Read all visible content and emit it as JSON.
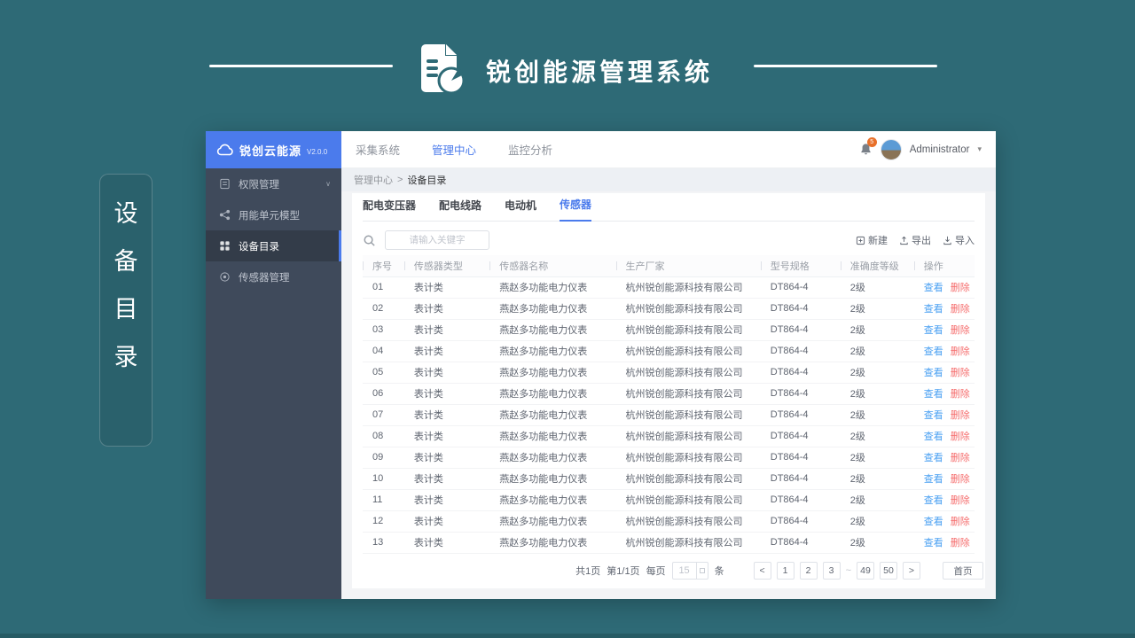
{
  "header": {
    "title": "锐创能源管理系统"
  },
  "side_label": {
    "chars": [
      "设",
      "备",
      "目",
      "录"
    ]
  },
  "app": {
    "sidebar": {
      "logo_text": "锐创云能源",
      "version": "V2.0.0",
      "items": [
        {
          "label": "权限管理",
          "icon": "document-icon",
          "chevron": true,
          "active": false
        },
        {
          "label": "用能单元模型",
          "icon": "share-icon",
          "chevron": false,
          "active": false
        },
        {
          "label": "设备目录",
          "icon": "grid-icon",
          "chevron": false,
          "active": true
        },
        {
          "label": "传感器管理",
          "icon": "target-icon",
          "chevron": false,
          "active": false
        }
      ]
    },
    "topnav": {
      "items": [
        {
          "label": "采集系统",
          "active": false
        },
        {
          "label": "管理中心",
          "active": true
        },
        {
          "label": "监控分析",
          "active": false
        }
      ],
      "badge": "5",
      "user_name": "Administrator"
    },
    "breadcrumb": {
      "parent": "管理中心",
      "separator": ">",
      "current": "设备目录"
    },
    "tabs": [
      {
        "label": "配电变压器",
        "active": false
      },
      {
        "label": "配电线路",
        "active": false
      },
      {
        "label": "电动机",
        "active": false
      },
      {
        "label": "传感器",
        "active": true
      }
    ],
    "toolbar": {
      "search_placeholder": "请输入关键字",
      "buttons": [
        {
          "label": "新建",
          "icon": "new-icon"
        },
        {
          "label": "导出",
          "icon": "export-icon"
        },
        {
          "label": "导入",
          "icon": "import-icon"
        }
      ]
    },
    "table": {
      "columns": [
        "序号",
        "传感器类型",
        "传感器名称",
        "生产厂家",
        "型号规格",
        "准确度等级",
        "操作"
      ],
      "action_view": "查看",
      "action_delete": "删除",
      "rows": [
        {
          "no": "01",
          "type": "表计类",
          "name": "燕赵多功能电力仪表",
          "vendor": "杭州锐创能源科技有限公司",
          "model": "DT864-4",
          "accuracy": "2级"
        },
        {
          "no": "02",
          "type": "表计类",
          "name": "燕赵多功能电力仪表",
          "vendor": "杭州锐创能源科技有限公司",
          "model": "DT864-4",
          "accuracy": "2级"
        },
        {
          "no": "03",
          "type": "表计类",
          "name": "燕赵多功能电力仪表",
          "vendor": "杭州锐创能源科技有限公司",
          "model": "DT864-4",
          "accuracy": "2级"
        },
        {
          "no": "04",
          "type": "表计类",
          "name": "燕赵多功能电力仪表",
          "vendor": "杭州锐创能源科技有限公司",
          "model": "DT864-4",
          "accuracy": "2级"
        },
        {
          "no": "05",
          "type": "表计类",
          "name": "燕赵多功能电力仪表",
          "vendor": "杭州锐创能源科技有限公司",
          "model": "DT864-4",
          "accuracy": "2级"
        },
        {
          "no": "06",
          "type": "表计类",
          "name": "燕赵多功能电力仪表",
          "vendor": "杭州锐创能源科技有限公司",
          "model": "DT864-4",
          "accuracy": "2级"
        },
        {
          "no": "07",
          "type": "表计类",
          "name": "燕赵多功能电力仪表",
          "vendor": "杭州锐创能源科技有限公司",
          "model": "DT864-4",
          "accuracy": "2级"
        },
        {
          "no": "08",
          "type": "表计类",
          "name": "燕赵多功能电力仪表",
          "vendor": "杭州锐创能源科技有限公司",
          "model": "DT864-4",
          "accuracy": "2级"
        },
        {
          "no": "09",
          "type": "表计类",
          "name": "燕赵多功能电力仪表",
          "vendor": "杭州锐创能源科技有限公司",
          "model": "DT864-4",
          "accuracy": "2级"
        },
        {
          "no": "10",
          "type": "表计类",
          "name": "燕赵多功能电力仪表",
          "vendor": "杭州锐创能源科技有限公司",
          "model": "DT864-4",
          "accuracy": "2级"
        },
        {
          "no": "11",
          "type": "表计类",
          "name": "燕赵多功能电力仪表",
          "vendor": "杭州锐创能源科技有限公司",
          "model": "DT864-4",
          "accuracy": "2级"
        },
        {
          "no": "12",
          "type": "表计类",
          "name": "燕赵多功能电力仪表",
          "vendor": "杭州锐创能源科技有限公司",
          "model": "DT864-4",
          "accuracy": "2级"
        },
        {
          "no": "13",
          "type": "表计类",
          "name": "燕赵多功能电力仪表",
          "vendor": "杭州锐创能源科技有限公司",
          "model": "DT864-4",
          "accuracy": "2级"
        }
      ]
    },
    "pagination": {
      "total_text": "共1页",
      "page_text": "第1/1页",
      "per_page_label": "每页",
      "per_page_value": "15",
      "unit_label": "条",
      "prev": "<",
      "next": ">",
      "pages": [
        "1",
        "2",
        "3",
        "~",
        "49",
        "50"
      ],
      "first_label": "首页"
    }
  },
  "colors": {
    "background_teal": "#2e6a76",
    "sidebar_dark": "#3f4a5b",
    "accent_blue": "#4b7bec",
    "link_blue": "#4aa0f2",
    "danger_red": "#f56c6c",
    "badge_orange": "#e8702a"
  }
}
